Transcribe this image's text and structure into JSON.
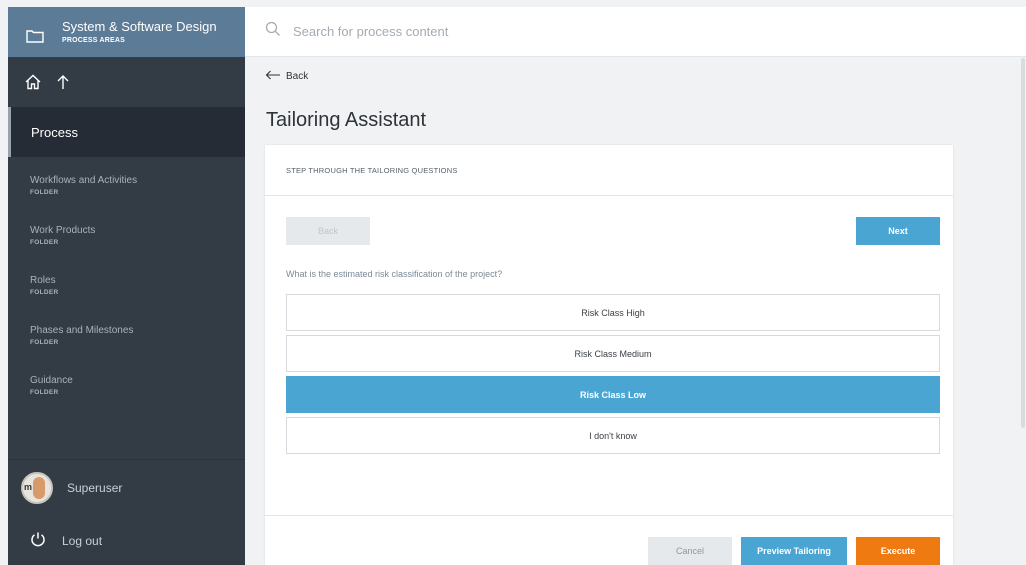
{
  "sidebar": {
    "area_title": "System & Software Design",
    "area_subtitle": "PROCESS AREAS",
    "process_label": "Process",
    "items": [
      {
        "label": "Workflows and Activities",
        "type": "FOLDER"
      },
      {
        "label": "Work Products",
        "type": "FOLDER"
      },
      {
        "label": "Roles",
        "type": "FOLDER"
      },
      {
        "label": "Phases and Milestones",
        "type": "FOLDER"
      },
      {
        "label": "Guidance",
        "type": "FOLDER"
      }
    ],
    "user": {
      "name": "Superuser",
      "avatar_text": "m"
    },
    "logout_label": "Log out"
  },
  "search": {
    "placeholder": "Search for process content"
  },
  "main": {
    "back_label": "Back",
    "title": "Tailoring Assistant"
  },
  "wizard": {
    "header": "STEP THROUGH THE TAILORING QUESTIONS",
    "back_button": "Back",
    "next_button": "Next",
    "question": "What is the estimated risk classification of the project?",
    "options": [
      {
        "label": "Risk Class High",
        "selected": false
      },
      {
        "label": "Risk Class Medium",
        "selected": false
      },
      {
        "label": "Risk Class Low",
        "selected": true
      },
      {
        "label": "I don't know",
        "selected": false
      }
    ],
    "cancel_button": "Cancel",
    "preview_button": "Preview Tailoring",
    "execute_button": "Execute"
  },
  "colors": {
    "sidebar_bg": "#333b45",
    "sidebar_header": "#5b7b97",
    "accent_blue": "#4aa5d3",
    "execute_orange": "#f07a12"
  }
}
